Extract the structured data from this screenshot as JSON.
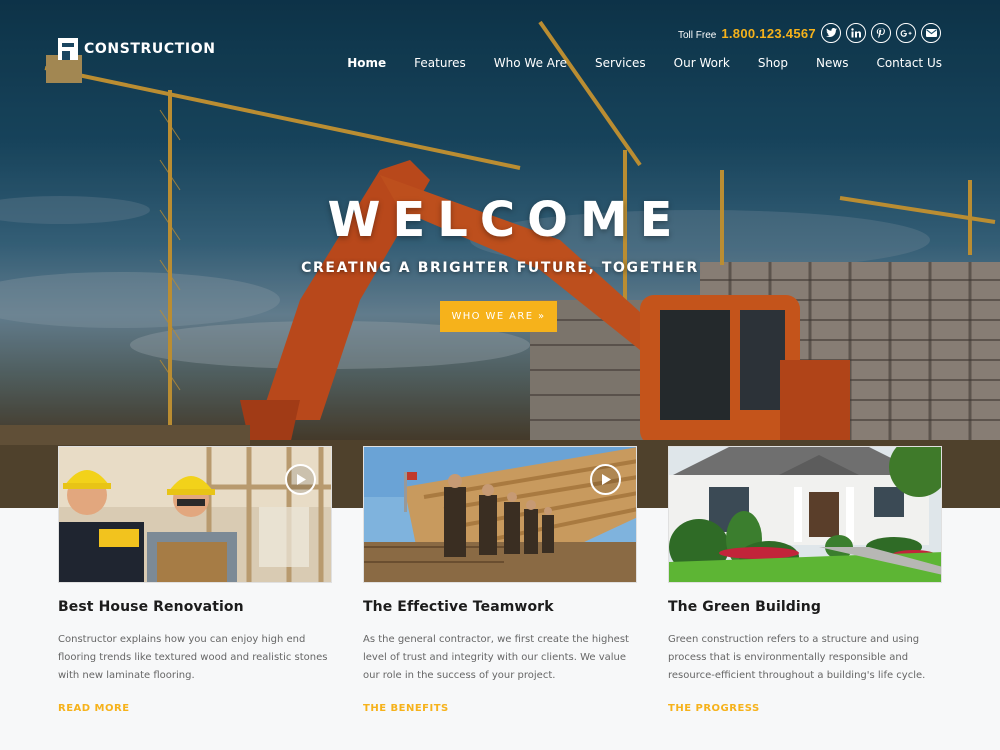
{
  "brand": {
    "name": "CONSTRUCTION",
    "accent": "#f6b21b"
  },
  "header": {
    "toll_label": "Toll Free",
    "toll_number": "1.800.123.4567",
    "socials": [
      "twitter-icon",
      "linkedin-icon",
      "pinterest-icon",
      "google-plus-icon",
      "email-icon"
    ],
    "nav": [
      "Home",
      "Features",
      "Who We Are",
      "Services",
      "Our Work",
      "Shop",
      "News",
      "Contact Us"
    ],
    "active_nav": "Home"
  },
  "hero": {
    "title": "WELCOME",
    "subtitle": "CREATING A BRIGHTER FUTURE, TOGETHER",
    "button": "WHO WE ARE »"
  },
  "cards": [
    {
      "title": "Best House Renovation",
      "text": "Constructor explains how you can enjoy high end flooring trends like textured wood and realistic stones with new laminate flooring.",
      "link": "READ MORE",
      "has_play": true
    },
    {
      "title": "The Effective Teamwork",
      "text": "As the general contractor, we first create the highest level of trust and integrity with our clients. We value our role in the success of your project.",
      "link": "THE BENEFITS",
      "has_play": true
    },
    {
      "title": "The Green Building",
      "text": "Green construction refers to a structure and using process that is environmentally responsible and resource-efficient throughout a building's life cycle.",
      "link": "THE PROGRESS",
      "has_play": false
    }
  ]
}
